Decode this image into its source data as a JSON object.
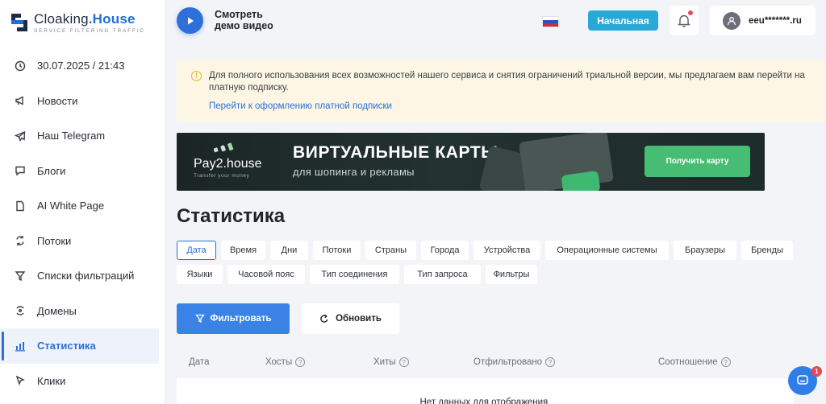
{
  "brand": {
    "name_part1": "Cloaking",
    "name_part2": ".House",
    "tagline": "SERVICE FILTERING TRAFFIC"
  },
  "sidebar": {
    "items": [
      {
        "label": "30.07.2025 / 21:43",
        "icon": "clock-icon"
      },
      {
        "label": "Новости",
        "icon": "megaphone-icon"
      },
      {
        "label": "Наш Telegram",
        "icon": "telegram-icon"
      },
      {
        "label": "Блоги",
        "icon": "chat-icon"
      },
      {
        "label": "AI White Page",
        "icon": "document-icon"
      },
      {
        "label": "Потоки",
        "icon": "repeat-icon"
      },
      {
        "label": "Списки фильтраций",
        "icon": "filter-icon"
      },
      {
        "label": "Домены",
        "icon": "domains-icon"
      },
      {
        "label": "Статистика",
        "icon": "bar-chart-icon",
        "active": true
      },
      {
        "label": "Клики",
        "icon": "cursor-icon"
      }
    ]
  },
  "header": {
    "demo_line1": "Смотреть",
    "demo_line2": "демо видео",
    "home_label": "Начальная",
    "user_email": "eeu*******.ru"
  },
  "alert": {
    "text": "Для полного использования всех возможностей нашего сервиса и снятия ограничений триальной версии, мы предлагаем вам перейти на платную подписку.",
    "link": "Перейти к оформлению платной подписки"
  },
  "banner": {
    "brand": "Pay2.house",
    "brand_sub": "Transfer your money",
    "title": "ВИРТУАЛЬНЫЕ КАРТЫ",
    "subtitle": "для шопинга и рекламы",
    "button": "Получить карту"
  },
  "page": {
    "title": "Статистика"
  },
  "tabs": [
    "Дата",
    "Время",
    "Дни",
    "Потоки",
    "Страны",
    "Города",
    "Устройства",
    "Операционные системы",
    "Браузеры",
    "Бренды",
    "Языки",
    "Часовой пояс",
    "Тип соединения",
    "Тип запроса",
    "Фильтры"
  ],
  "actions": {
    "filter": "Фильтровать",
    "refresh": "Обновить"
  },
  "table": {
    "columns": [
      "Дата",
      "Хосты",
      "Хиты",
      "Отфильтровано",
      "Соотношение"
    ],
    "empty": "Нет данных для отображения."
  },
  "chat_badge": "1",
  "colors": {
    "accent": "#2a6fd6",
    "home_button": "#28a9d8",
    "banner_button": "#46bd72",
    "alert_bg": "#fdf6e4"
  }
}
